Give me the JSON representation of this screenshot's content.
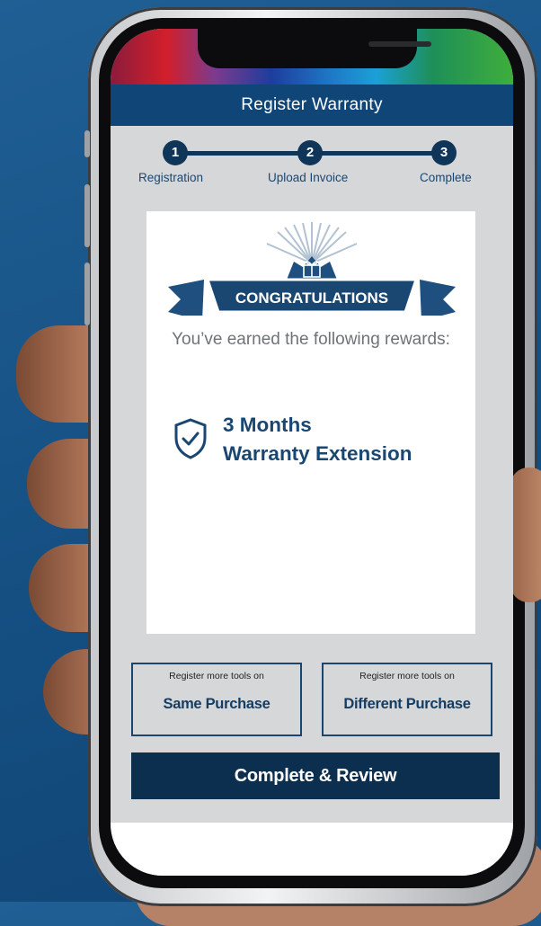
{
  "header": {
    "title": "Register Warranty"
  },
  "stepper": {
    "steps": [
      {
        "number": "1",
        "label": "Registration"
      },
      {
        "number": "2",
        "label": "Upload Invoice"
      },
      {
        "number": "3",
        "label": "Complete"
      }
    ],
    "current_step": 3
  },
  "congrats": {
    "banner_text": "CONGRATULATIONS",
    "rewards_intro": "You’ve earned the following rewards:",
    "reward_line1": "3 Months",
    "reward_line2": "Warranty Extension",
    "icons": [
      "gift-icon",
      "shield-check-icon"
    ]
  },
  "options": {
    "same": {
      "caption": "Register more tools on",
      "label": "Same Purchase"
    },
    "different": {
      "caption": "Register more tools on",
      "label": "Different Purchase"
    }
  },
  "actions": {
    "complete_label": "Complete & Review"
  },
  "colors": {
    "primary": "#0f4677",
    "dark": "#0c2e4f",
    "screen_bg": "#d6d7d9",
    "background": "#154f82"
  }
}
